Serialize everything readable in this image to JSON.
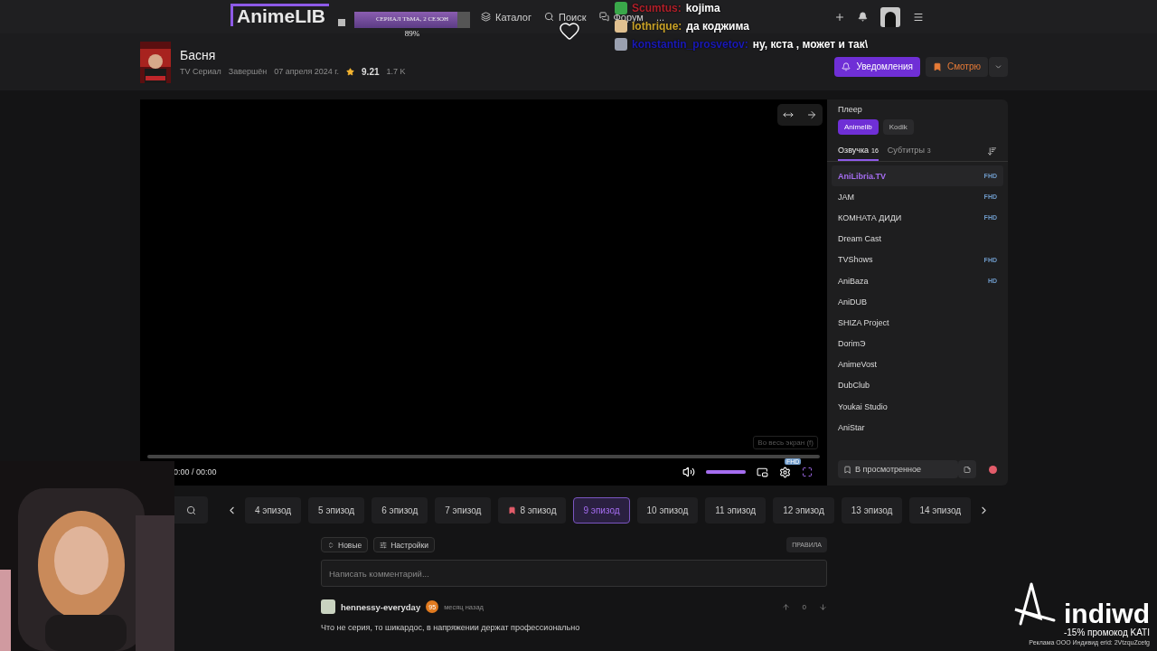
{
  "header": {
    "logo": "AnimeLIB",
    "nav": [
      {
        "label": "Каталог",
        "kind": "catalog"
      },
      {
        "label": "Поиск",
        "kind": "search"
      },
      {
        "label": "Форум",
        "kind": "forum"
      },
      {
        "label": "...",
        "kind": "more"
      }
    ]
  },
  "anime": {
    "title": "Басня",
    "type": "TV Сериал",
    "status": "Завершён",
    "date": "07 апреля 2024 г.",
    "rating": "9.21",
    "votes": "1.7 K"
  },
  "actions": [
    {
      "label": "Уведомления",
      "kind": "primary"
    },
    {
      "label": "Смотрю",
      "kind": "list"
    }
  ],
  "player": {
    "time": "0:00 / 00:00",
    "volume": {
      "level": 1
    },
    "quality": "FHD",
    "tooltip": "Во весь экран (f)"
  },
  "panel": {
    "title": "Плеер",
    "sources": [
      {
        "label": "Animelib",
        "selected": true
      },
      {
        "label": "Kodik",
        "selected": false
      }
    ],
    "tabs": [
      {
        "label": "Озвучка",
        "count": "16",
        "selected": true
      },
      {
        "label": "Субтитры",
        "count": "3",
        "selected": false
      }
    ],
    "teams": [
      {
        "name": "AniLibria.TV",
        "quality": "FHD",
        "selected": true
      },
      {
        "name": "JAM",
        "quality": "FHD",
        "selected": false
      },
      {
        "name": "КОМНАТА ДИДИ",
        "quality": "FHD",
        "selected": false
      },
      {
        "name": "Dream Cast",
        "selected": false
      },
      {
        "name": "TVShows",
        "quality": "FHD",
        "selected": false
      },
      {
        "name": "AniBaza",
        "quality": "HD",
        "selected": false
      },
      {
        "name": "AniDUB",
        "selected": false
      },
      {
        "name": "SHIZA Project",
        "selected": false
      },
      {
        "name": "DorimЭ",
        "selected": false
      },
      {
        "name": "AnimeVost",
        "selected": false
      },
      {
        "name": "DubClub",
        "selected": false
      },
      {
        "name": "Youkai Studio",
        "selected": false
      },
      {
        "name": "AniStar",
        "selected": false
      }
    ],
    "watched_button": "В просмотренное"
  },
  "episodes": [
    {
      "label": "4 эпизод",
      "selected": false,
      "bookmarked": false
    },
    {
      "label": "5 эпизод",
      "selected": false,
      "bookmarked": false
    },
    {
      "label": "6 эпизод",
      "selected": false,
      "bookmarked": false
    },
    {
      "label": "7 эпизод",
      "selected": false,
      "bookmarked": false
    },
    {
      "label": "8 эпизод",
      "selected": false,
      "bookmarked": true
    },
    {
      "label": "9 эпизод",
      "selected": true,
      "bookmarked": false
    },
    {
      "label": "10 эпизод",
      "selected": false,
      "bookmarked": false
    },
    {
      "label": "11 эпизод",
      "selected": false,
      "bookmarked": false
    },
    {
      "label": "12 эпизод",
      "selected": false,
      "bookmarked": false
    },
    {
      "label": "13 эпизод",
      "selected": false,
      "bookmarked": false
    },
    {
      "label": "14 эпизод",
      "selected": false,
      "bookmarked": false
    }
  ],
  "comments": {
    "sort": "Новые",
    "settings": "Настройки",
    "rules": "ПРАВИЛА",
    "placeholder": "Написать комментарий...",
    "items": [
      {
        "user": "hennessy-everyday",
        "level": "95",
        "time": "месяц назад",
        "votes": "0",
        "text": "Что не серия, то шикардос, в напряжении держат профессионально"
      }
    ]
  },
  "stream_progress": {
    "title": "СЕРИАЛ ТЬМА, 2 СЕЗОН",
    "percent": "89%",
    "level": 0.89
  },
  "chat": [
    {
      "user": "Scumtus:",
      "color": "#b0202a",
      "text": "kojima"
    },
    {
      "user": "lothrique:",
      "color": "#c9a227",
      "text": "да коджима"
    },
    {
      "user": "konstantin_prosvetov:",
      "color": "#1a1ab8",
      "text": "ну, кста , может и так\\"
    }
  ],
  "ad": {
    "brand": "indiwd",
    "promo": "-15% промокод KATI",
    "legal": "Реклама ООО Индивид erid: 2VtzquZcetg"
  }
}
